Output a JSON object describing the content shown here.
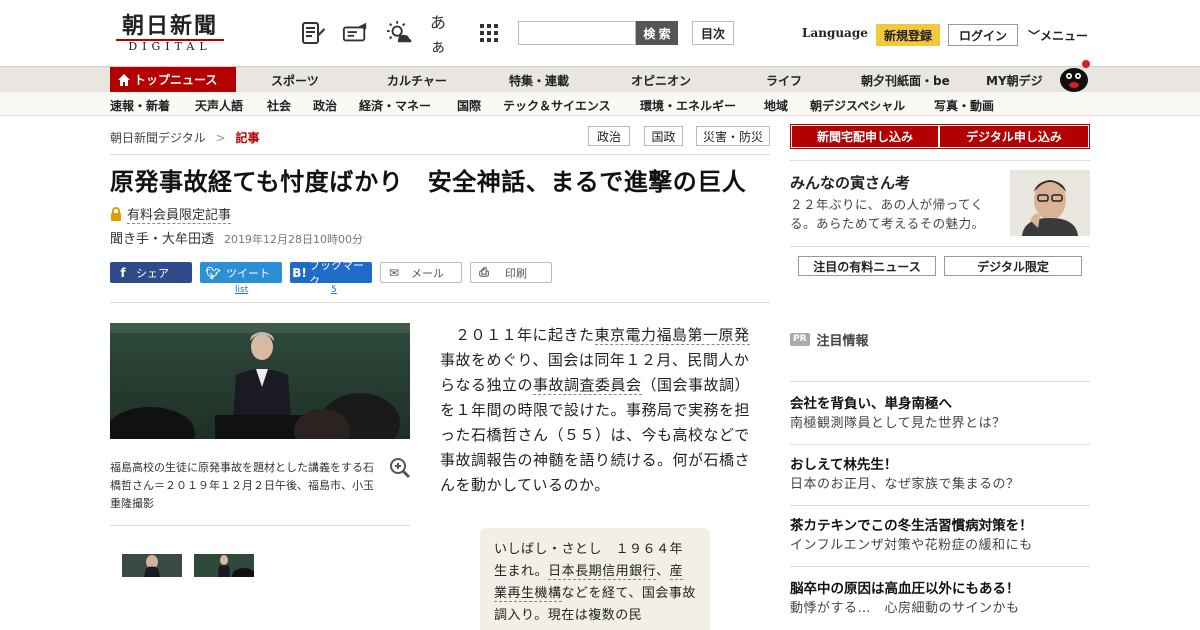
{
  "header": {
    "logo_main": "朝日新聞",
    "logo_sub": "DIGITAL",
    "search_placeholder": "",
    "search_button": "検 索",
    "contents_button": "目次",
    "language": "Language",
    "register": "新規登録",
    "login": "ログイン",
    "menu": "メニュー",
    "icons": [
      "newspaper-edit-icon",
      "ticket-icon",
      "weather-icon",
      "text-size-icon",
      "apps-grid-icon"
    ],
    "text_size_label": "あぁ"
  },
  "nav_main": {
    "top_news": "トップニュース",
    "items": [
      "スポーツ",
      "カルチャー",
      "特集・連載",
      "オピニオン",
      "ライフ",
      "朝夕刊紙面・be",
      "MY朝デジ"
    ]
  },
  "nav_sub": {
    "items": [
      "速報・新着",
      "天声人語",
      "社会",
      "政治",
      "経済・マネー",
      "国際",
      "テック＆サイエンス",
      "環境・エネルギー",
      "地域",
      "朝デジスペシャル",
      "写真・動画"
    ]
  },
  "breadcrumb": {
    "home": "朝日新聞デジタル",
    "sep": ">",
    "current": "記事"
  },
  "tags": [
    "政治",
    "国政",
    "災害・防災"
  ],
  "article": {
    "title": "原発事故経ても忖度ばかり　安全神話、まるで進撃の巨人",
    "paid_label": "有料会員限定記事",
    "author": "聞き手・大牟田透",
    "date": "2019年12月28日10時00分",
    "share": {
      "facebook": "シェア",
      "twitter": "ツイート",
      "twitter_count": "list",
      "hatena": "ブックマーク",
      "hatena_count": "5",
      "mail": "メール",
      "print": "印刷"
    },
    "caption": "福島高校の生徒に原発事故を題材とした講義をする石橋哲さん＝２０１９年１２月２日午後、福島市、小玉重隆撮影",
    "body": {
      "p1_a": "２０１１年に起きた",
      "p1_link1": "東京電力福島第一原発",
      "p1_b": "事故をめぐり、国会は同年１２月、民間人からなる独立の",
      "p1_link2": "事故調査委員会",
      "p1_c": "（国会事故調）を１年間の時限で設けた。事務局で実務を担った石橋哲さん（５５）は、今も高校などで事故調報告の神髄を語り続ける。何が石橋さんを動かしているのか。"
    },
    "profile": {
      "a": "いしばし・さとし　１９６４年生まれ。",
      "link1": "日本長期信用銀行",
      "b": "、",
      "link2": "産業再生機構",
      "c": "などを経て、国会事故調入り。現在は複数の民"
    }
  },
  "sidebar": {
    "apply_newspaper": "新聞宅配申し込み",
    "apply_digital": "デジタル申し込み",
    "feature_title": "みんなの寅さん考",
    "feature_desc": "２２年ぶりに、あの人が帰ってくる。あらためて考えるその魅力。",
    "tab_news": "注目の有料ニュース",
    "tab_digital": "デジタル限定",
    "pr_badge": "PR",
    "pr_heading": "注目情報",
    "pr_items": [
      {
        "title": "会社を背負い、単身南極へ",
        "desc": "南極観測隊員として見た世界とは？"
      },
      {
        "title": "おしえて林先生！",
        "desc": "日本のお正月、なぜ家族で集まるの？"
      },
      {
        "title": "茶カテキンでこの冬生活習慣病対策を！",
        "desc": "インフルエンザ対策や花粉症の緩和にも"
      },
      {
        "title": "脳卒中の原因は高血圧以外にもある！",
        "desc": "動悸がする…　心房細動のサインかも"
      }
    ]
  },
  "colors": {
    "brand_red": "#b30000",
    "register_yellow": "#f3c83d",
    "facebook": "#2d4b8b",
    "twitter": "#2b8fd6",
    "hatena": "#1f6bc9"
  }
}
